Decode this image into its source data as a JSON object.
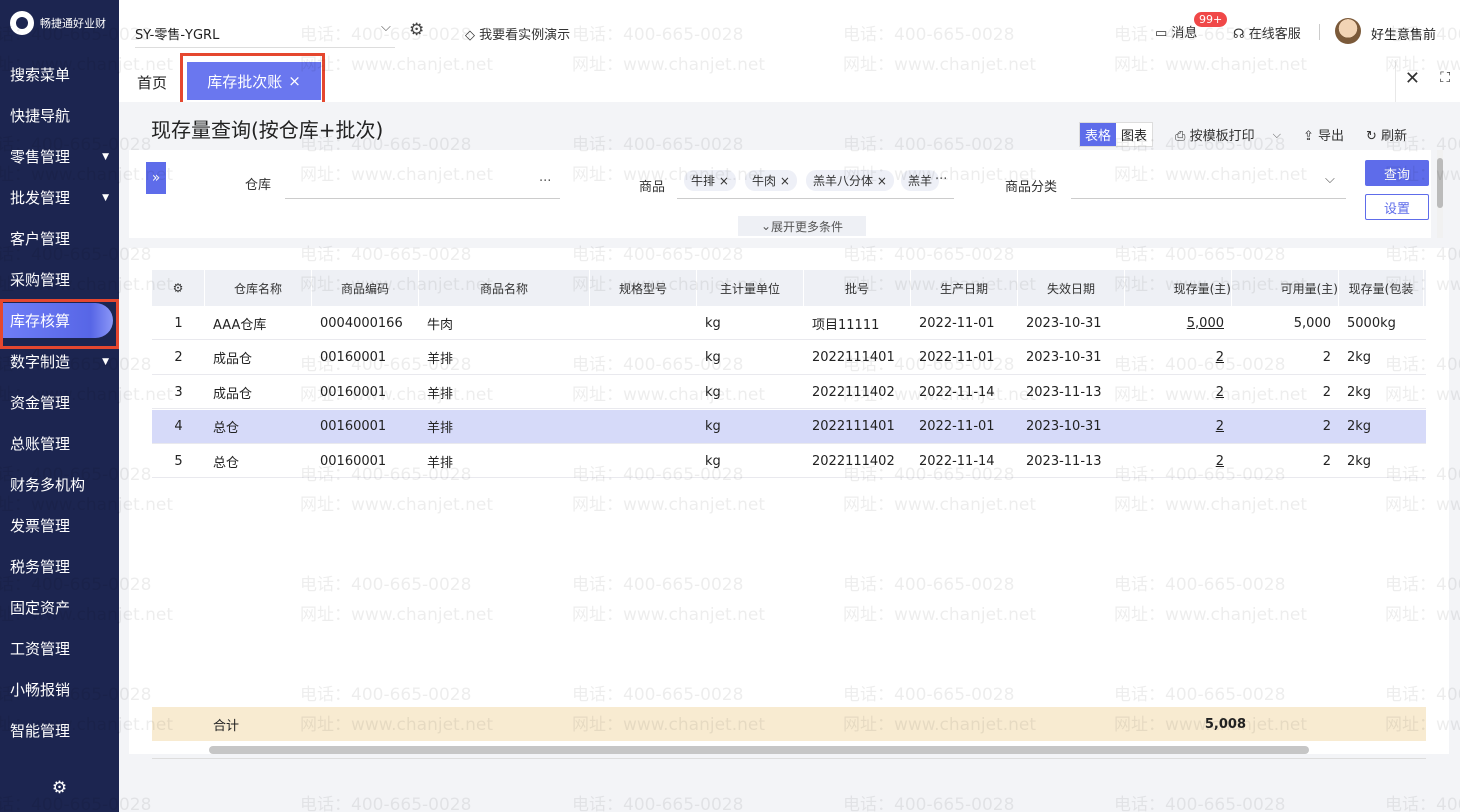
{
  "logo": {
    "text": "畅捷通好业财"
  },
  "sidebar": {
    "items": [
      {
        "label": "搜索菜单",
        "caret": false
      },
      {
        "label": "快捷导航",
        "caret": false
      },
      {
        "label": "零售管理",
        "caret": true
      },
      {
        "label": "批发管理",
        "caret": true
      },
      {
        "label": "客户管理",
        "caret": false
      },
      {
        "label": "采购管理",
        "caret": false
      },
      {
        "label": "库存核算",
        "caret": false,
        "active": true
      },
      {
        "label": "数字制造",
        "caret": true
      },
      {
        "label": "资金管理",
        "caret": false
      },
      {
        "label": "总账管理",
        "caret": false
      },
      {
        "label": "财务多机构",
        "caret": false
      },
      {
        "label": "发票管理",
        "caret": false
      },
      {
        "label": "税务管理",
        "caret": false
      },
      {
        "label": "固定资产",
        "caret": false
      },
      {
        "label": "工资管理",
        "caret": false
      },
      {
        "label": "小畅报销",
        "caret": false
      },
      {
        "label": "智能管理",
        "caret": false
      }
    ]
  },
  "topbar": {
    "org": "SY-零售-YGRL",
    "demo": "我要看实例演示",
    "message": "消息",
    "badge": "99+",
    "service": "在线客服",
    "user": "好生意售前"
  },
  "tabs": {
    "home": "首页",
    "active": "库存批次账"
  },
  "page": {
    "title": "现存量查询(按仓库+批次)"
  },
  "toolbar": {
    "view_table": "表格",
    "view_chart": "图表",
    "print": "按模板打印",
    "export": "导出",
    "refresh": "刷新"
  },
  "filter": {
    "warehouse_label": "仓库",
    "warehouse_value": "···",
    "goods_label": "商品",
    "goods_chips": [
      "牛排",
      "牛肉",
      "羔羊八分体",
      "羔羊"
    ],
    "goods_more": "···",
    "category_label": "商品分类",
    "query": "查询",
    "settings": "设置",
    "more": "展开更多条件"
  },
  "table": {
    "columns": [
      "仓库名称",
      "商品编码",
      "商品名称",
      "规格型号",
      "主计量单位",
      "批号",
      "生产日期",
      "失效日期",
      "现存量(主)",
      "可用量(主)",
      "现存量(包装"
    ],
    "rows": [
      [
        "1",
        "AAA仓库",
        "0004000166",
        "牛肉",
        "",
        "kg",
        "项目11111",
        "2022-11-01",
        "2023-10-31",
        "5,000",
        "5,000",
        "5000kg"
      ],
      [
        "2",
        "成品仓",
        "00160001",
        "羊排",
        "",
        "kg",
        "2022111401",
        "2022-11-01",
        "2023-10-31",
        "2",
        "2",
        "2kg"
      ],
      [
        "3",
        "成品仓",
        "00160001",
        "羊排",
        "",
        "kg",
        "2022111402",
        "2022-11-14",
        "2023-11-13",
        "2",
        "2",
        "2kg"
      ],
      [
        "4",
        "总仓",
        "00160001",
        "羊排",
        "",
        "kg",
        "2022111401",
        "2022-11-01",
        "2023-10-31",
        "2",
        "2",
        "2kg"
      ],
      [
        "5",
        "总仓",
        "00160001",
        "羊排",
        "",
        "kg",
        "2022111402",
        "2022-11-14",
        "2023-11-13",
        "2",
        "2",
        "2kg"
      ]
    ],
    "total_label": "合计",
    "total_value": "5,008"
  },
  "watermark": {
    "phone": "电话：400-665-0028",
    "site": "网址：www.chanjet.net"
  },
  "colors": {
    "sidebar": "#1c2550",
    "accent": "#5e6cea",
    "highlight_row": "#d6daf9",
    "total_row": "#f8ebd1",
    "outline": "#e5472f"
  }
}
